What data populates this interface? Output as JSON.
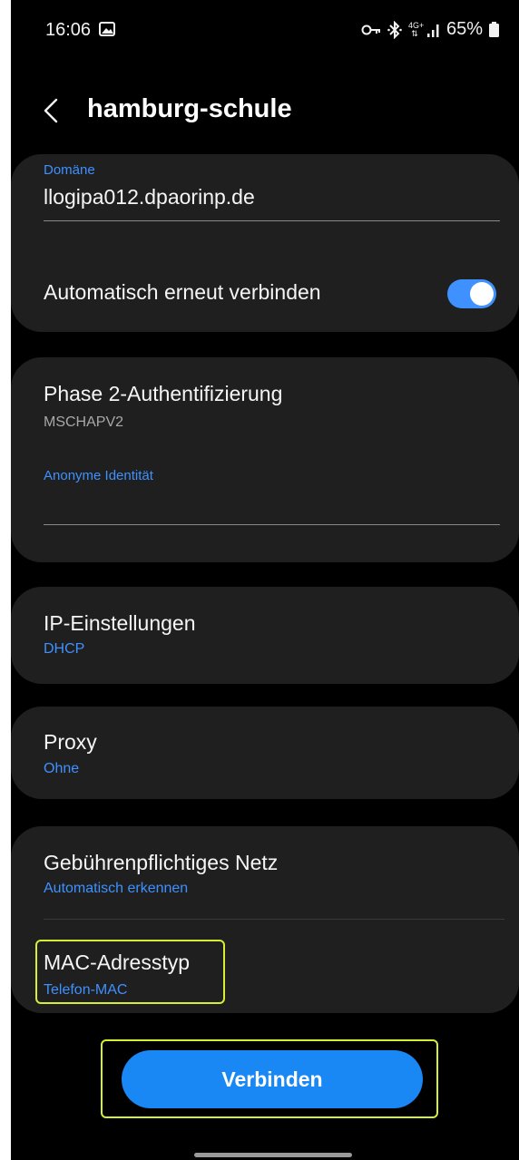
{
  "status_bar": {
    "time": "16:06",
    "network": "4G+",
    "battery": "65%",
    "icons": [
      "gallery-icon",
      "vpn-key-icon",
      "bluetooth-icon",
      "network-type-icon",
      "signal-icon",
      "battery-icon"
    ]
  },
  "header": {
    "title": "hamburg-schule",
    "back_icon": "chevron-left-icon"
  },
  "domain": {
    "label": "Domäne",
    "value": "llogipa012.dpaorinp.de"
  },
  "auto_reconnect": {
    "label": "Automatisch erneut verbinden",
    "enabled": true
  },
  "phase2": {
    "title": "Phase 2-Authentifizierung",
    "value": "MSCHAPV2"
  },
  "anonymous_identity": {
    "label": "Anonyme Identität",
    "value": ""
  },
  "ip_settings": {
    "title": "IP-Einstellungen",
    "value": "DHCP"
  },
  "proxy": {
    "title": "Proxy",
    "value": "Ohne"
  },
  "metered": {
    "title": "Gebührenpflichtiges Netz",
    "value": "Automatisch erkennen"
  },
  "mac_type": {
    "title": "MAC-Adresstyp",
    "value": "Telefon-MAC"
  },
  "connect_button": {
    "label": "Verbinden"
  },
  "colors": {
    "accent": "#3e91ff",
    "button": "#1a88f4",
    "card": "#1f1f1f",
    "highlight": "#d6ef33"
  }
}
